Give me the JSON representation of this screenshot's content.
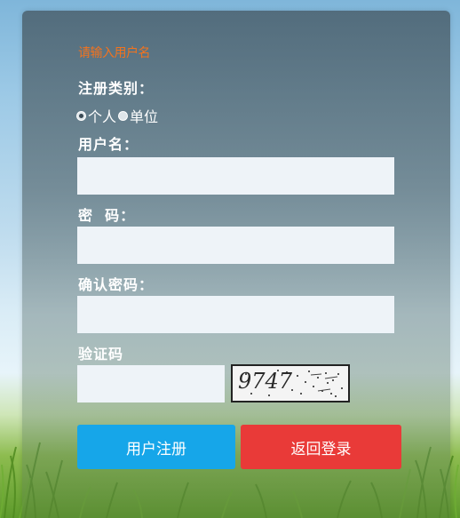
{
  "form": {
    "hint": "请输入用户名",
    "type_label": "注册类别：",
    "type_options": [
      {
        "label": "个人",
        "checked": true
      },
      {
        "label": "单位",
        "checked": false
      }
    ],
    "username_label": "用户名：",
    "username_value": "",
    "password_label": "密  码：",
    "password_value": "",
    "confirm_label": "确认密码：",
    "confirm_value": "",
    "captcha_label": "验证码",
    "captcha_value": "",
    "captcha_image_text": "9747"
  },
  "buttons": {
    "register": "用户注册",
    "back": "返回登录"
  },
  "colors": {
    "hint": "#f2731e",
    "register_button": "#16a6e9",
    "back_button": "#e93a38",
    "input_background": "#eef3f8"
  }
}
